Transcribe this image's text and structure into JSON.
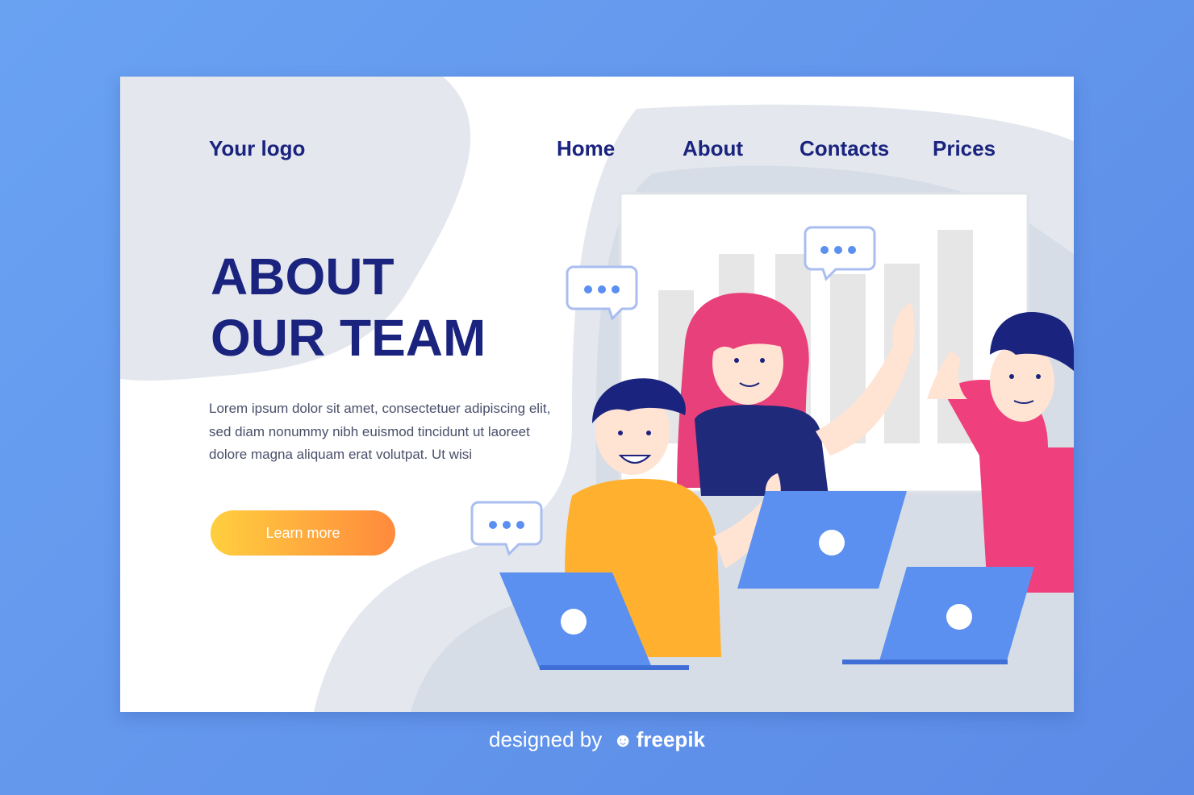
{
  "nav": {
    "logo": "Your logo",
    "links": [
      "Home",
      "About",
      "Contacts",
      "Prices"
    ]
  },
  "hero": {
    "title_line1": "ABOUT",
    "title_line2": "OUR TEAM",
    "description": "Lorem ipsum dolor sit amet, consectetuer adipiscing elit, sed diam nonummy nibh euismod tincidunt ut laoreet dolore magna aliquam erat volutpat. Ut wisi",
    "cta_label": "Learn more"
  },
  "footer": {
    "prefix": "designed by",
    "brand": "freepik"
  },
  "colors": {
    "page_background": "#5f92ec",
    "heading": "#1a237e",
    "cta_start": "#ffcf3e",
    "cta_end": "#ff8a3d",
    "laptop": "#5b8ff0",
    "shirt_orange": "#ffb02e",
    "shirt_navy": "#1f2a7a",
    "shirt_pink": "#ef3f7c",
    "hair_pink": "#e8407a",
    "hair_navy": "#1a237e"
  },
  "illustration": {
    "icons": [
      "chart-board-icon",
      "speech-bubble-icon",
      "person-icon",
      "laptop-icon"
    ]
  }
}
